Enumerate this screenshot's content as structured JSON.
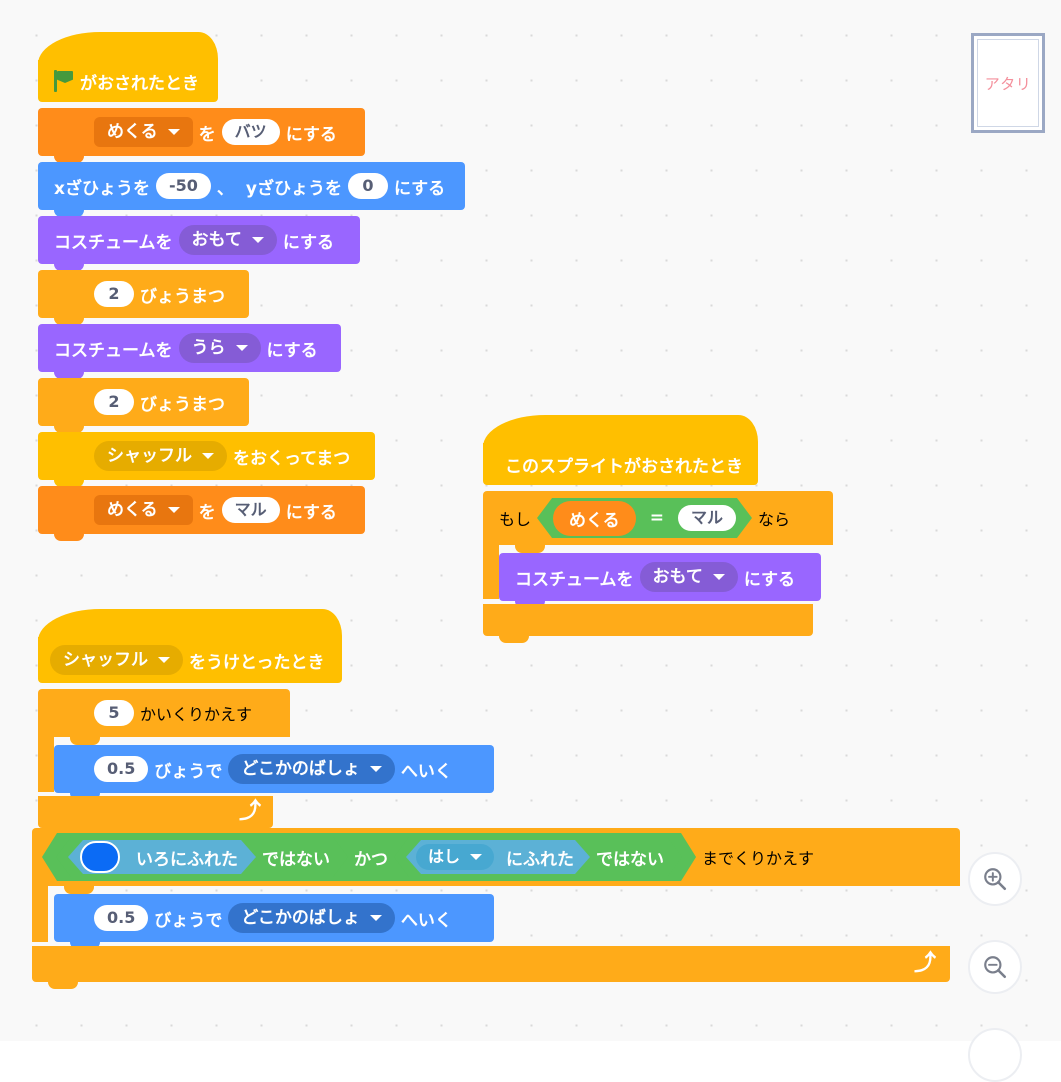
{
  "app": {
    "kind": "scratch-block-editor",
    "colors": {
      "events": "#FFBF00",
      "control": "#FFAB19",
      "motion": "#4C97FF",
      "looks": "#9966FF",
      "variables": "#FF8C1A",
      "sensing": "#5CB1D6",
      "operators": "#59C059",
      "canvas": "#f9f9f9",
      "swatch": "#0B6BF5",
      "sprite_label": "#F4909C"
    }
  },
  "sprite_card": {
    "name": "アタリ",
    "icon": "costume-thumbnail"
  },
  "zoom_controls": {
    "zoom_in": "zoom-in",
    "zoom_out": "zoom-out",
    "zoom_reset": "zoom-reset"
  },
  "scripts": [
    {
      "id": "script-green-flag",
      "hat": {
        "icon": "green-flag-icon",
        "label": "がおされたとき"
      },
      "blocks": [
        {
          "type": "set-variable",
          "dropdown": "めくる",
          "mid": "を",
          "value": "バツ",
          "tail": "にする"
        },
        {
          "type": "goto-xy",
          "label_x": "xざひょうを",
          "x": "-50",
          "sep": "、",
          "label_y": "yざひょうを",
          "y": "0",
          "tail": "にする"
        },
        {
          "type": "switch-costume",
          "label": "コスチュームを",
          "dropdown": "おもて",
          "tail": "にする"
        },
        {
          "type": "wait",
          "value": "2",
          "tail": "びょうまつ"
        },
        {
          "type": "switch-costume",
          "label": "コスチュームを",
          "dropdown": "うら",
          "tail": "にする"
        },
        {
          "type": "wait",
          "value": "2",
          "tail": "びょうまつ"
        },
        {
          "type": "broadcast-and-wait",
          "dropdown": "シャッフル",
          "tail": "をおくってまつ"
        },
        {
          "type": "set-variable",
          "dropdown": "めくる",
          "mid": "を",
          "value": "マル",
          "tail": "にする"
        }
      ]
    },
    {
      "id": "script-sprite-clicked",
      "hat": {
        "label": "このスプライトがおされたとき"
      },
      "if_block": {
        "prefix": "もし",
        "condition": {
          "left_variable": "めくる",
          "operator": "=",
          "right_value": "マル"
        },
        "suffix": "なら",
        "body": [
          {
            "type": "switch-costume",
            "label": "コスチュームを",
            "dropdown": "おもて",
            "tail": "にする"
          }
        ]
      }
    },
    {
      "id": "script-on-broadcast",
      "hat": {
        "dropdown": "シャッフル",
        "label": "をうけとったとき"
      },
      "repeat_block": {
        "value": "5",
        "tail": "かいくりかえす",
        "body": [
          {
            "type": "glide-to",
            "value": "0.5",
            "mid": "びょうで",
            "dropdown": "どこかのばしょ",
            "tail": "へいく"
          }
        ]
      },
      "repeat_until_block": {
        "condition": {
          "operator": "かつ",
          "left": {
            "not": "ではない",
            "inner": {
              "type": "touching-color",
              "swatch": "#0B6BF5",
              "label": "いろにふれた"
            }
          },
          "right": {
            "not": "ではない",
            "inner": {
              "type": "touching",
              "dropdown": "はし",
              "label": "にふれた"
            }
          }
        },
        "tail": "までくりかえす",
        "body": [
          {
            "type": "glide-to",
            "value": "0.5",
            "mid": "びょうで",
            "dropdown": "どこかのばしょ",
            "tail": "へいく"
          }
        ]
      }
    }
  ]
}
